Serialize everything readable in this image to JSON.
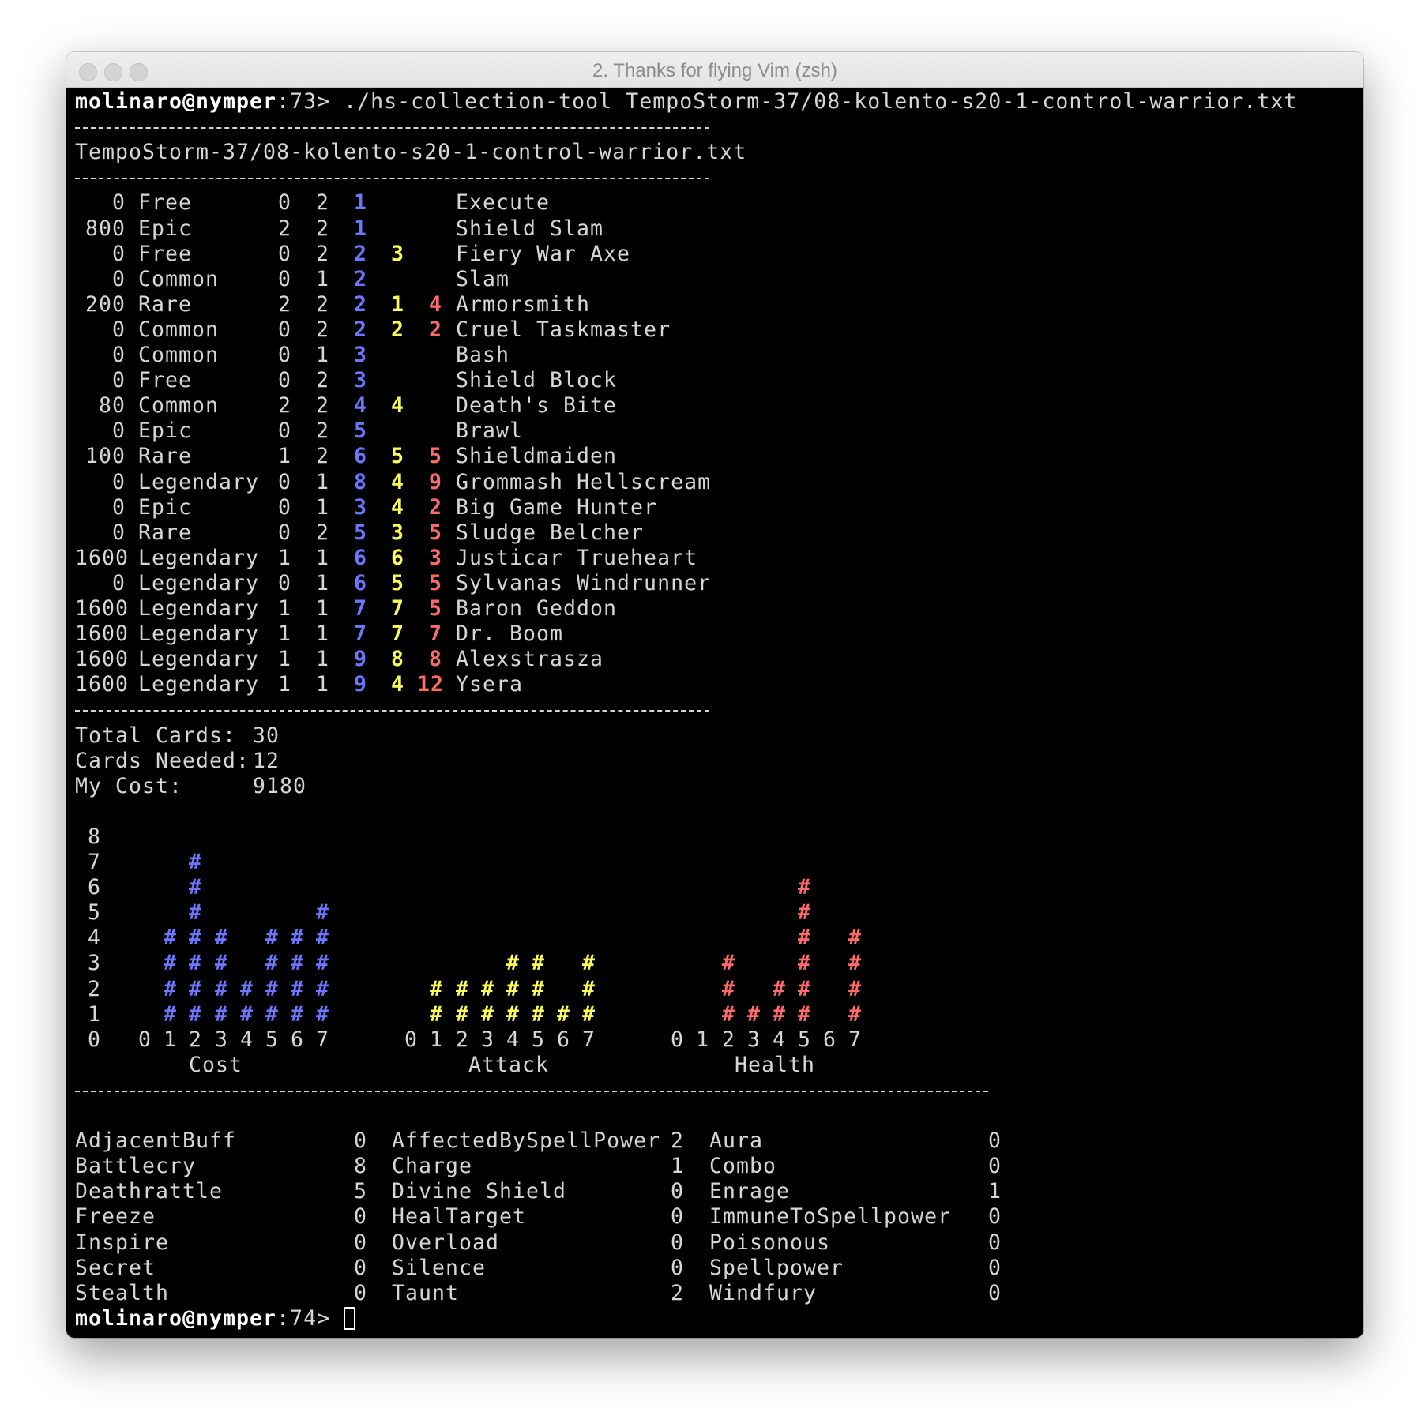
{
  "window": {
    "title": "2. Thanks for flying Vim (zsh)"
  },
  "prompt1": {
    "user_host": "molinaro@nymper",
    "rest": ":73> ./hs-collection-tool TempoStorm-37/08-kolento-s20-1-control-warrior.txt"
  },
  "deck_name": "TempoStorm-37/08-kolento-s20-1-control-warrior.txt",
  "cards": [
    {
      "dust": "0",
      "rarity": "Free",
      "needed": "0",
      "count": "2",
      "cost": "1",
      "attack": "",
      "health": "",
      "name": "Execute"
    },
    {
      "dust": "800",
      "rarity": "Epic",
      "needed": "2",
      "count": "2",
      "cost": "1",
      "attack": "",
      "health": "",
      "name": "Shield Slam"
    },
    {
      "dust": "0",
      "rarity": "Free",
      "needed": "0",
      "count": "2",
      "cost": "2",
      "attack": "3",
      "health": "",
      "name": "Fiery War Axe"
    },
    {
      "dust": "0",
      "rarity": "Common",
      "needed": "0",
      "count": "1",
      "cost": "2",
      "attack": "",
      "health": "",
      "name": "Slam"
    },
    {
      "dust": "200",
      "rarity": "Rare",
      "needed": "2",
      "count": "2",
      "cost": "2",
      "attack": "1",
      "health": "4",
      "name": "Armorsmith"
    },
    {
      "dust": "0",
      "rarity": "Common",
      "needed": "0",
      "count": "2",
      "cost": "2",
      "attack": "2",
      "health": "2",
      "name": "Cruel Taskmaster"
    },
    {
      "dust": "0",
      "rarity": "Common",
      "needed": "0",
      "count": "1",
      "cost": "3",
      "attack": "",
      "health": "",
      "name": "Bash"
    },
    {
      "dust": "0",
      "rarity": "Free",
      "needed": "0",
      "count": "2",
      "cost": "3",
      "attack": "",
      "health": "",
      "name": "Shield Block"
    },
    {
      "dust": "80",
      "rarity": "Common",
      "needed": "2",
      "count": "2",
      "cost": "4",
      "attack": "4",
      "health": "",
      "name": "Death's Bite"
    },
    {
      "dust": "0",
      "rarity": "Epic",
      "needed": "0",
      "count": "2",
      "cost": "5",
      "attack": "",
      "health": "",
      "name": "Brawl"
    },
    {
      "dust": "100",
      "rarity": "Rare",
      "needed": "1",
      "count": "2",
      "cost": "6",
      "attack": "5",
      "health": "5",
      "name": "Shieldmaiden"
    },
    {
      "dust": "0",
      "rarity": "Legendary",
      "needed": "0",
      "count": "1",
      "cost": "8",
      "attack": "4",
      "health": "9",
      "name": "Grommash Hellscream"
    },
    {
      "dust": "0",
      "rarity": "Epic",
      "needed": "0",
      "count": "1",
      "cost": "3",
      "attack": "4",
      "health": "2",
      "name": "Big Game Hunter"
    },
    {
      "dust": "0",
      "rarity": "Rare",
      "needed": "0",
      "count": "2",
      "cost": "5",
      "attack": "3",
      "health": "5",
      "name": "Sludge Belcher"
    },
    {
      "dust": "1600",
      "rarity": "Legendary",
      "needed": "1",
      "count": "1",
      "cost": "6",
      "attack": "6",
      "health": "3",
      "name": "Justicar Trueheart"
    },
    {
      "dust": "0",
      "rarity": "Legendary",
      "needed": "0",
      "count": "1",
      "cost": "6",
      "attack": "5",
      "health": "5",
      "name": "Sylvanas Windrunner"
    },
    {
      "dust": "1600",
      "rarity": "Legendary",
      "needed": "1",
      "count": "1",
      "cost": "7",
      "attack": "7",
      "health": "5",
      "name": "Baron Geddon"
    },
    {
      "dust": "1600",
      "rarity": "Legendary",
      "needed": "1",
      "count": "1",
      "cost": "7",
      "attack": "7",
      "health": "7",
      "name": "Dr. Boom"
    },
    {
      "dust": "1600",
      "rarity": "Legendary",
      "needed": "1",
      "count": "1",
      "cost": "9",
      "attack": "8",
      "health": "8",
      "name": "Alexstrasza"
    },
    {
      "dust": "1600",
      "rarity": "Legendary",
      "needed": "1",
      "count": "1",
      "cost": "9",
      "attack": "4",
      "health": "12",
      "name": "Ysera"
    }
  ],
  "summary": {
    "total_label": "Total Cards:",
    "total_value": "30",
    "needed_label": "Cards Needed:",
    "needed_value": "12",
    "cost_label": "My Cost:",
    "cost_value": "9180"
  },
  "histograms": {
    "y_ticks": [
      "8",
      "7",
      "6",
      "5",
      "4",
      "3",
      "2",
      "1",
      "0"
    ],
    "x_ticks": [
      "0",
      "1",
      "2",
      "3",
      "4",
      "5",
      "6",
      "7"
    ],
    "mark": "#",
    "colors": {
      "cost": "#6b77ff",
      "attack": "#fbfb5a",
      "health": "#ff6a6a"
    }
  },
  "chart_data": [
    {
      "type": "bar",
      "xlabel": "Cost",
      "categories": [
        "0",
        "1",
        "2",
        "3",
        "4",
        "5",
        "6",
        "7"
      ],
      "values": [
        0,
        4,
        7,
        4,
        2,
        4,
        4,
        5
      ],
      "ylim": [
        0,
        8
      ],
      "color": "#6b77ff"
    },
    {
      "type": "bar",
      "xlabel": "Attack",
      "categories": [
        "0",
        "1",
        "2",
        "3",
        "4",
        "5",
        "6",
        "7"
      ],
      "values": [
        0,
        2,
        2,
        2,
        3,
        3,
        1,
        3
      ],
      "ylim": [
        0,
        8
      ],
      "color": "#fbfb5a"
    },
    {
      "type": "bar",
      "xlabel": "Health",
      "categories": [
        "0",
        "1",
        "2",
        "3",
        "4",
        "5",
        "6",
        "7"
      ],
      "values": [
        0,
        0,
        3,
        1,
        2,
        6,
        0,
        4
      ],
      "ylim": [
        0,
        8
      ],
      "color": "#ff6a6a"
    }
  ],
  "mechanics": [
    [
      {
        "name": "AdjacentBuff",
        "count": "0"
      },
      {
        "name": "AffectedBySpellPower",
        "count": "2"
      },
      {
        "name": "Aura",
        "count": "0"
      }
    ],
    [
      {
        "name": "Battlecry",
        "count": "8"
      },
      {
        "name": "Charge",
        "count": "1"
      },
      {
        "name": "Combo",
        "count": "0"
      }
    ],
    [
      {
        "name": "Deathrattle",
        "count": "5"
      },
      {
        "name": "Divine Shield",
        "count": "0"
      },
      {
        "name": "Enrage",
        "count": "1"
      }
    ],
    [
      {
        "name": "Freeze",
        "count": "0"
      },
      {
        "name": "HealTarget",
        "count": "0"
      },
      {
        "name": "ImmuneToSpellpower",
        "count": "0"
      }
    ],
    [
      {
        "name": "Inspire",
        "count": "0"
      },
      {
        "name": "Overload",
        "count": "0"
      },
      {
        "name": "Poisonous",
        "count": "0"
      }
    ],
    [
      {
        "name": "Secret",
        "count": "0"
      },
      {
        "name": "Silence",
        "count": "0"
      },
      {
        "name": "Spellpower",
        "count": "0"
      }
    ],
    [
      {
        "name": "Stealth",
        "count": "0"
      },
      {
        "name": "Taunt",
        "count": "2"
      },
      {
        "name": "Windfury",
        "count": "0"
      }
    ]
  ],
  "prompt2": {
    "user_host": "molinaro@nymper",
    "rest": ":74> "
  }
}
